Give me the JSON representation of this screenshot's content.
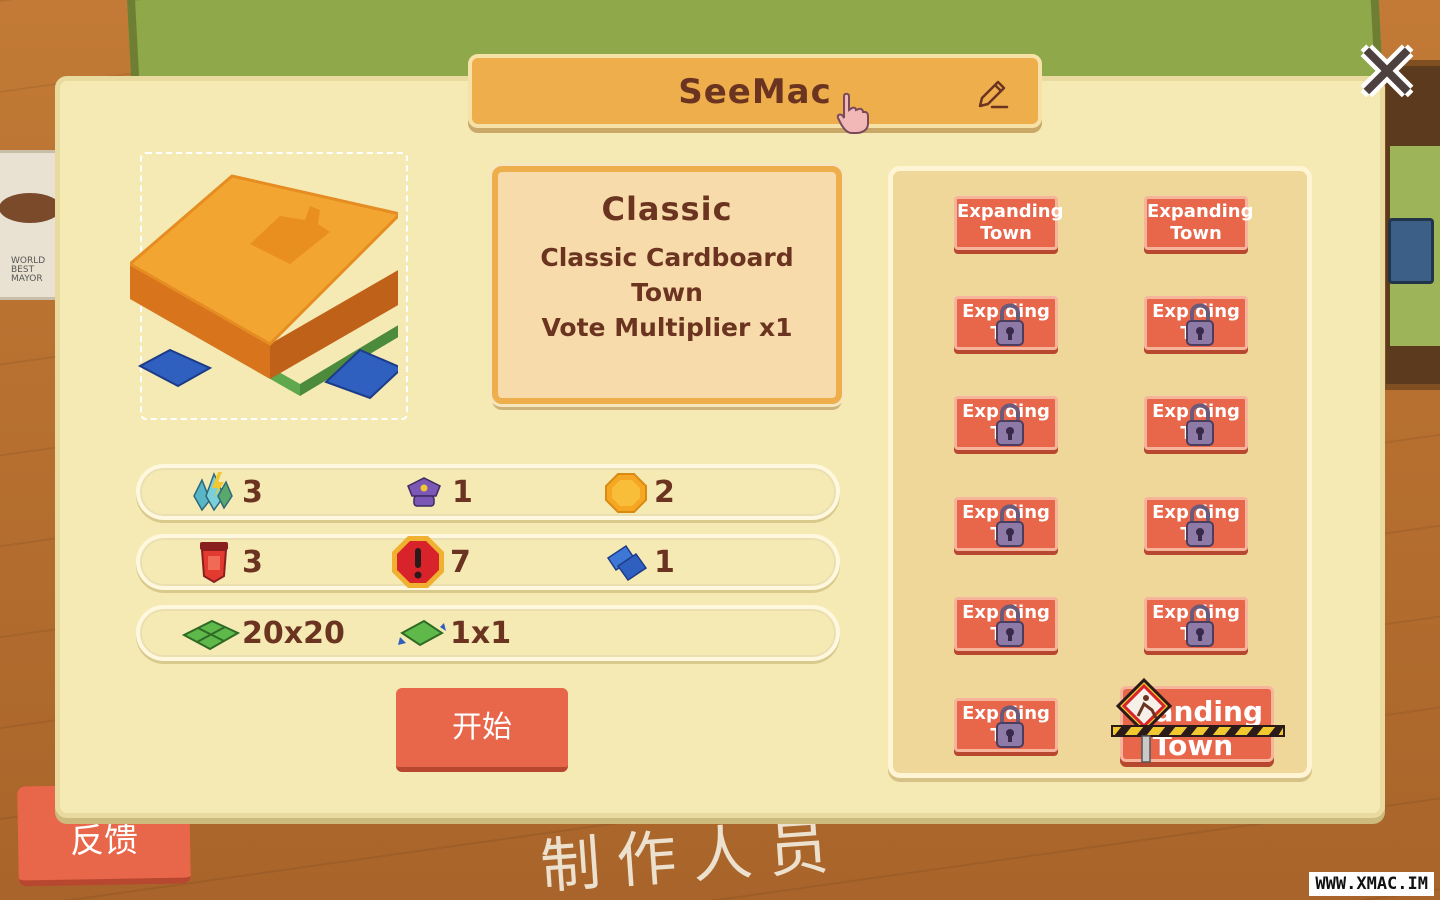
{
  "player": {
    "name": "SeeMac"
  },
  "town": {
    "name": "Classic",
    "description_lines": [
      "Classic Cardboard",
      "Town",
      "Vote Multiplier x1"
    ]
  },
  "stats": {
    "row1": [
      {
        "icon": "crystal-icon",
        "value": "3"
      },
      {
        "icon": "police-hat-icon",
        "value": "1"
      },
      {
        "icon": "coin-icon",
        "value": "2"
      }
    ],
    "row2": [
      {
        "icon": "red-banner-icon",
        "value": "3"
      },
      {
        "icon": "warning-icon",
        "value": "7"
      },
      {
        "icon": "blueprint-icon",
        "value": "1"
      }
    ],
    "row3": [
      {
        "icon": "land-grid-icon",
        "value": "20x20"
      },
      {
        "icon": "plot-icon",
        "value": "1x1"
      }
    ]
  },
  "buttons": {
    "start": "开始",
    "feedback": "反馈",
    "close": "✕"
  },
  "towns_list": {
    "unlocked_tile": {
      "line1": "Expanding",
      "line2": "Town"
    },
    "locked_tile": {
      "line1": "Exp   ding",
      "line2": "T     n"
    },
    "construction_tile": {
      "line1": "anding",
      "line2": "Town"
    }
  },
  "background": {
    "chalk_text": "制作人员",
    "mug_text": "WORLD BEST MAYOR"
  },
  "watermark": "WWW.XMAC.IM",
  "colors": {
    "panel": "#f6eab4",
    "accent_orange": "#eeae4c",
    "button_red": "#e8664a",
    "text_brown": "#6b3421"
  }
}
